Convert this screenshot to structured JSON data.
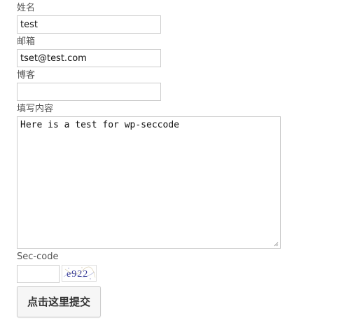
{
  "form": {
    "name": {
      "label": "姓名",
      "value": "test"
    },
    "email": {
      "label": "邮箱",
      "value": "tset@test.com"
    },
    "website": {
      "label": "博客",
      "value": ""
    },
    "content": {
      "label": "填写内容",
      "value": "Here is a test for wp-seccode"
    },
    "seccode": {
      "label": "Sec-code",
      "value": "",
      "captcha_text": "e922"
    },
    "submit_label": "点击这里提交"
  },
  "colors": {
    "border": "#cccccc",
    "label_text": "#555555",
    "captcha_text": "#3a3f9a",
    "button_background": "#f6f6f6"
  }
}
